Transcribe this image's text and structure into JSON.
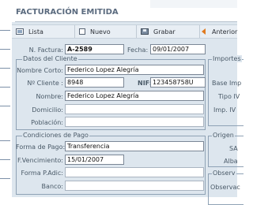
{
  "page": {
    "title": "FACTURACIÓN EMITIDA"
  },
  "toolbar": {
    "list_label": "Lista",
    "new_label": "Nuevo",
    "save_label": "Grabar",
    "prev_label": "Anterior"
  },
  "invoice": {
    "number_label": "N. Factura:",
    "number_value": "A-2589",
    "date_label": "Fecha:",
    "date_value": "09/01/2007"
  },
  "client_section": {
    "title": "Datos del Cliente",
    "short_name_label": "Nombre Corto:",
    "short_name_value": "Federico Lopez Alegría",
    "client_no_label": "Nº Cliente :",
    "client_no_value": "8948",
    "nif_label": "NIF:",
    "nif_value": "123458758U",
    "name_label": "Nombre:",
    "name_value": "Federico Lopez Alegría",
    "address_label": "Domicilio:",
    "address_value": "",
    "city_label": "Población:",
    "city_value": ""
  },
  "payment_section": {
    "title": "Condiciones de Pago",
    "method_label": "Forma de Pago:",
    "method_value": "Transferencia",
    "due_label": "F.Vencimiento:",
    "due_value": "15/01/2007",
    "method_extra_label": "Forma P.Adic:",
    "method_extra_value": "",
    "bank_label": "Banco:",
    "bank_value": ""
  },
  "right_sections": {
    "amounts_title": "Importes",
    "base_label": "Base Imp",
    "vat_type_label": "Tipo IV",
    "vat_amount_label": "Imp. IV",
    "origin_title": "Origen",
    "sa_label": "SA",
    "alba_label": "Alba",
    "notes_title": "Observ",
    "notes_label": "Observac"
  }
}
